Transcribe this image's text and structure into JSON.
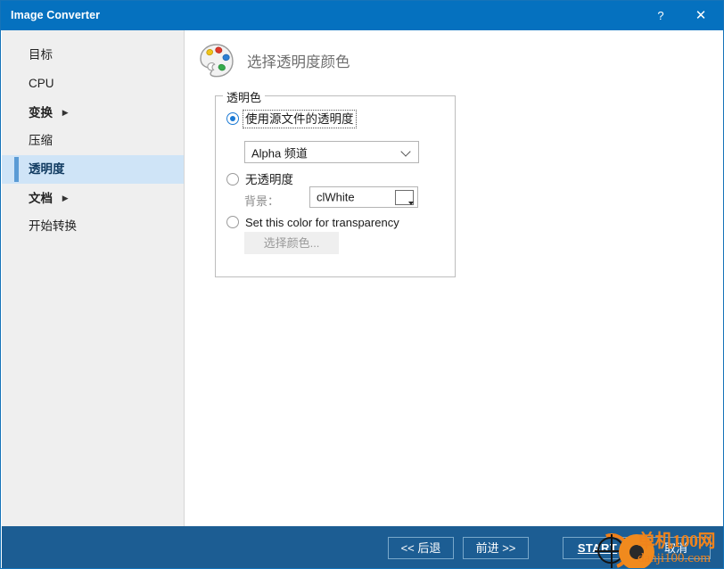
{
  "window": {
    "title": "Image Converter",
    "help_label": "?",
    "close_label": "✕",
    "titlebar_color": "#0571bf",
    "footer_color": "#1c5d93",
    "accent_color": "#5b9bd5",
    "selection_color": "#cfe4f7"
  },
  "sidebar": {
    "items": [
      {
        "label": "目标",
        "bold": false,
        "arrow": "",
        "selected": false
      },
      {
        "label": "CPU",
        "bold": false,
        "arrow": "",
        "selected": false
      },
      {
        "label": "变换",
        "bold": true,
        "arrow": "▶",
        "selected": false
      },
      {
        "label": "压缩",
        "bold": false,
        "arrow": "",
        "selected": false
      },
      {
        "label": "透明度",
        "bold": true,
        "arrow": "",
        "selected": true
      },
      {
        "label": "文档",
        "bold": true,
        "arrow": "▶",
        "selected": false
      },
      {
        "label": "开始转换",
        "bold": false,
        "arrow": "",
        "selected": false
      }
    ]
  },
  "page": {
    "icon": "palette-icon",
    "title": "选择透明度颜色"
  },
  "group": {
    "legend": "透明色",
    "option_source": {
      "label": "使用源文件的透明度",
      "checked": true,
      "focused": true
    },
    "alpha_combo": {
      "value": "Alpha 频道",
      "icon": "chevron-down-icon"
    },
    "option_opaque": {
      "label": "无透明度",
      "checked": false
    },
    "background_label": "背景：",
    "color_combo": {
      "value": "clWhite",
      "swatch_color": "#ffffff",
      "icon": "dropdown-arrow-icon"
    },
    "option_pick": {
      "label": "Set this color for transparency",
      "checked": false
    },
    "pick_color_button": "选择颜色..."
  },
  "footer": {
    "back": "<< 后退",
    "next": "前进 >>",
    "start": "START",
    "cancel": "取消"
  },
  "watermark": {
    "line1": "单机100网",
    "line2": "danji100.com",
    "color": "#f0831c"
  }
}
